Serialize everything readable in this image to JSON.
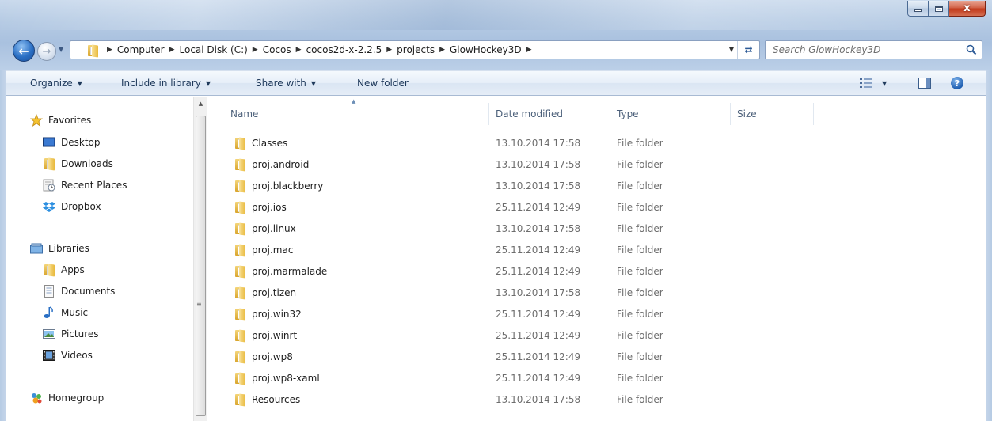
{
  "window": {
    "minimize_icon": "minimize-icon",
    "maximize_icon": "maximize-icon",
    "close_label": "x"
  },
  "navigation": {
    "back_icon": "back-arrow-icon",
    "forward_icon": "forward-arrow-icon",
    "breadcrumbs": [
      "Computer",
      "Local Disk (C:)",
      "Cocos",
      "cocos2d-x-2.2.5",
      "projects",
      "GlowHockey3D"
    ],
    "search_placeholder": "Search GlowHockey3D"
  },
  "toolbar": {
    "organize": "Organize",
    "include_in_library": "Include in library",
    "share_with": "Share with",
    "new_folder": "New folder",
    "help_label": "?"
  },
  "sidebar": {
    "favorites": {
      "title": "Favorites",
      "items": [
        "Desktop",
        "Downloads",
        "Recent Places",
        "Dropbox"
      ]
    },
    "libraries": {
      "title": "Libraries",
      "items": [
        "Apps",
        "Documents",
        "Music",
        "Pictures",
        "Videos"
      ]
    },
    "homegroup": "Homegroup"
  },
  "file_list": {
    "columns": {
      "name": "Name",
      "date_modified": "Date modified",
      "type": "Type",
      "size": "Size"
    },
    "rows": [
      {
        "name": "Classes",
        "date": "13.10.2014 17:58",
        "type": "File folder"
      },
      {
        "name": "proj.android",
        "date": "13.10.2014 17:58",
        "type": "File folder"
      },
      {
        "name": "proj.blackberry",
        "date": "13.10.2014 17:58",
        "type": "File folder"
      },
      {
        "name": "proj.ios",
        "date": "25.11.2014 12:49",
        "type": "File folder"
      },
      {
        "name": "proj.linux",
        "date": "13.10.2014 17:58",
        "type": "File folder"
      },
      {
        "name": "proj.mac",
        "date": "25.11.2014 12:49",
        "type": "File folder"
      },
      {
        "name": "proj.marmalade",
        "date": "25.11.2014 12:49",
        "type": "File folder"
      },
      {
        "name": "proj.tizen",
        "date": "13.10.2014 17:58",
        "type": "File folder"
      },
      {
        "name": "proj.win32",
        "date": "25.11.2014 12:49",
        "type": "File folder"
      },
      {
        "name": "proj.winrt",
        "date": "25.11.2014 12:49",
        "type": "File folder"
      },
      {
        "name": "proj.wp8",
        "date": "25.11.2014 12:49",
        "type": "File folder"
      },
      {
        "name": "proj.wp8-xaml",
        "date": "25.11.2014 12:49",
        "type": "File folder"
      },
      {
        "name": "Resources",
        "date": "13.10.2014 17:58",
        "type": "File folder"
      }
    ]
  },
  "colors": {
    "frame": "#b6cbe4",
    "command_text": "#1e395b",
    "muted_text": "#6d6d6d",
    "folder": "#e8b83a"
  }
}
